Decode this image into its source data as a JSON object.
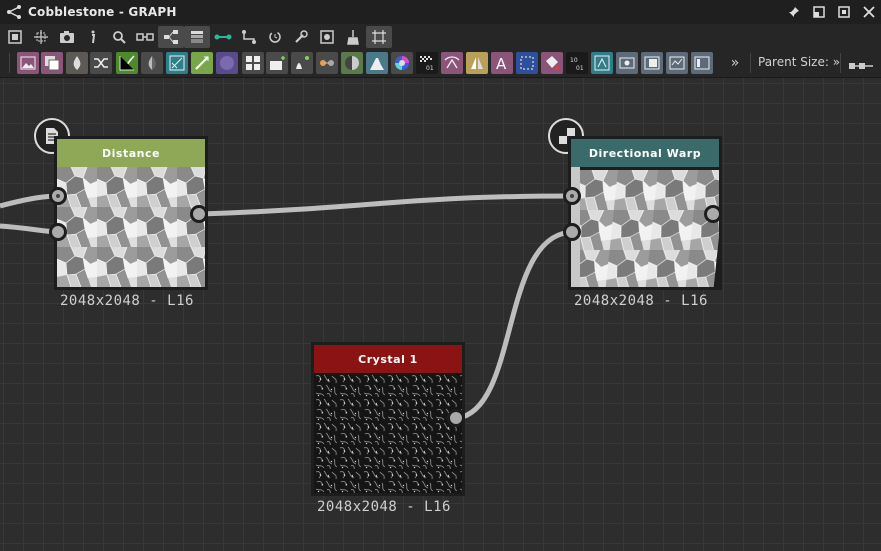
{
  "window": {
    "title": "Cobblestone - GRAPH"
  },
  "toolbar2": {
    "more_label": "»",
    "parent_size_label": "Parent Size:"
  },
  "icons": {
    "titlebar": [
      "graph-icon",
      "pin-icon",
      "maximize-icon",
      "fullscreen-icon",
      "close-icon"
    ],
    "toolbar1": [
      "frame-all-icon",
      "frame-selected-icon",
      "screenshot-icon",
      "info-icon",
      "search-icon",
      "link-icon",
      "hierarchy-icon",
      "layers-icon",
      "connection-icon",
      "path-icon",
      "refresh-icon",
      "wrench-icon",
      "display-icon",
      "clean-icon",
      "snap-grid-icon"
    ]
  },
  "nodes": [
    {
      "id": "distance",
      "title": "Distance",
      "size_label": "2048x2048 - L16",
      "header_color": "#8ea858",
      "badge": "document-icon"
    },
    {
      "id": "directional-warp",
      "title": "Directional Warp",
      "size_label": "2048x2048 - L16",
      "header_color": "#3b6a6a",
      "badge": "checker-icon"
    },
    {
      "id": "crystal",
      "title": "Crystal 1",
      "size_label": "2048x2048 - L16",
      "header_color": "#8a1414",
      "badge": ""
    }
  ]
}
